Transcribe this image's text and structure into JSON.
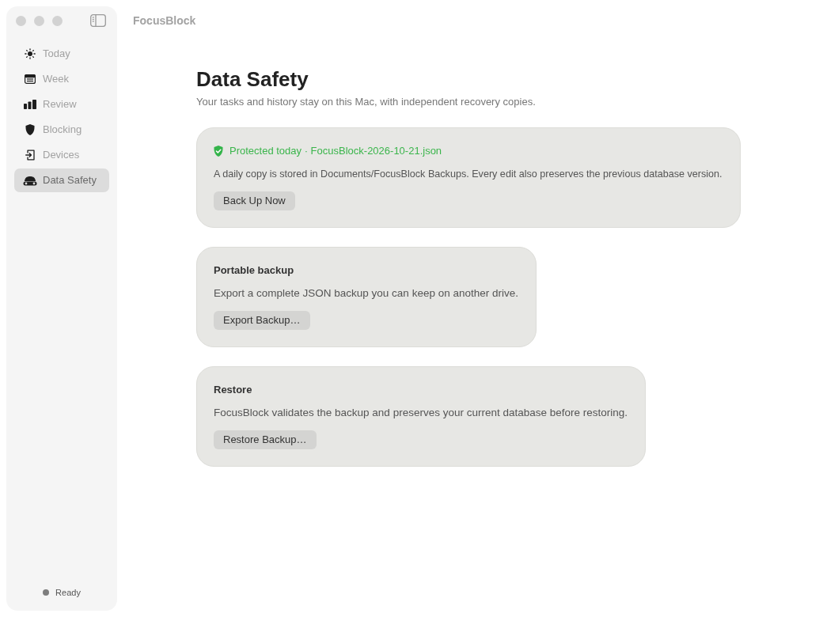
{
  "window": {
    "title": "FocusBlock"
  },
  "sidebar": {
    "items": [
      {
        "label": "Today",
        "selected": false
      },
      {
        "label": "Week",
        "selected": false
      },
      {
        "label": "Review",
        "selected": false
      },
      {
        "label": "Blocking",
        "selected": false
      },
      {
        "label": "Devices",
        "selected": false
      },
      {
        "label": "Data Safety",
        "selected": true
      }
    ],
    "status": "Ready"
  },
  "page": {
    "title": "Data Safety",
    "subtitle": "Your tasks and history stay on this Mac, with independent recovery copies."
  },
  "cards": [
    {
      "kind": "status",
      "status": "Protected today · FocusBlock-2026-10-21.json",
      "description": "A daily copy is stored in Documents/FocusBlock Backups. Every edit also preserves the previous database version.",
      "button": "Back Up Now"
    },
    {
      "kind": "section",
      "title": "Portable backup",
      "description": "Export a complete JSON backup you can keep on another drive.",
      "button": "Export Backup…"
    },
    {
      "kind": "section",
      "title": "Restore",
      "description": "FocusBlock validates the backup and preserves your current database before restoring.",
      "button": "Restore Backup…"
    }
  ]
}
